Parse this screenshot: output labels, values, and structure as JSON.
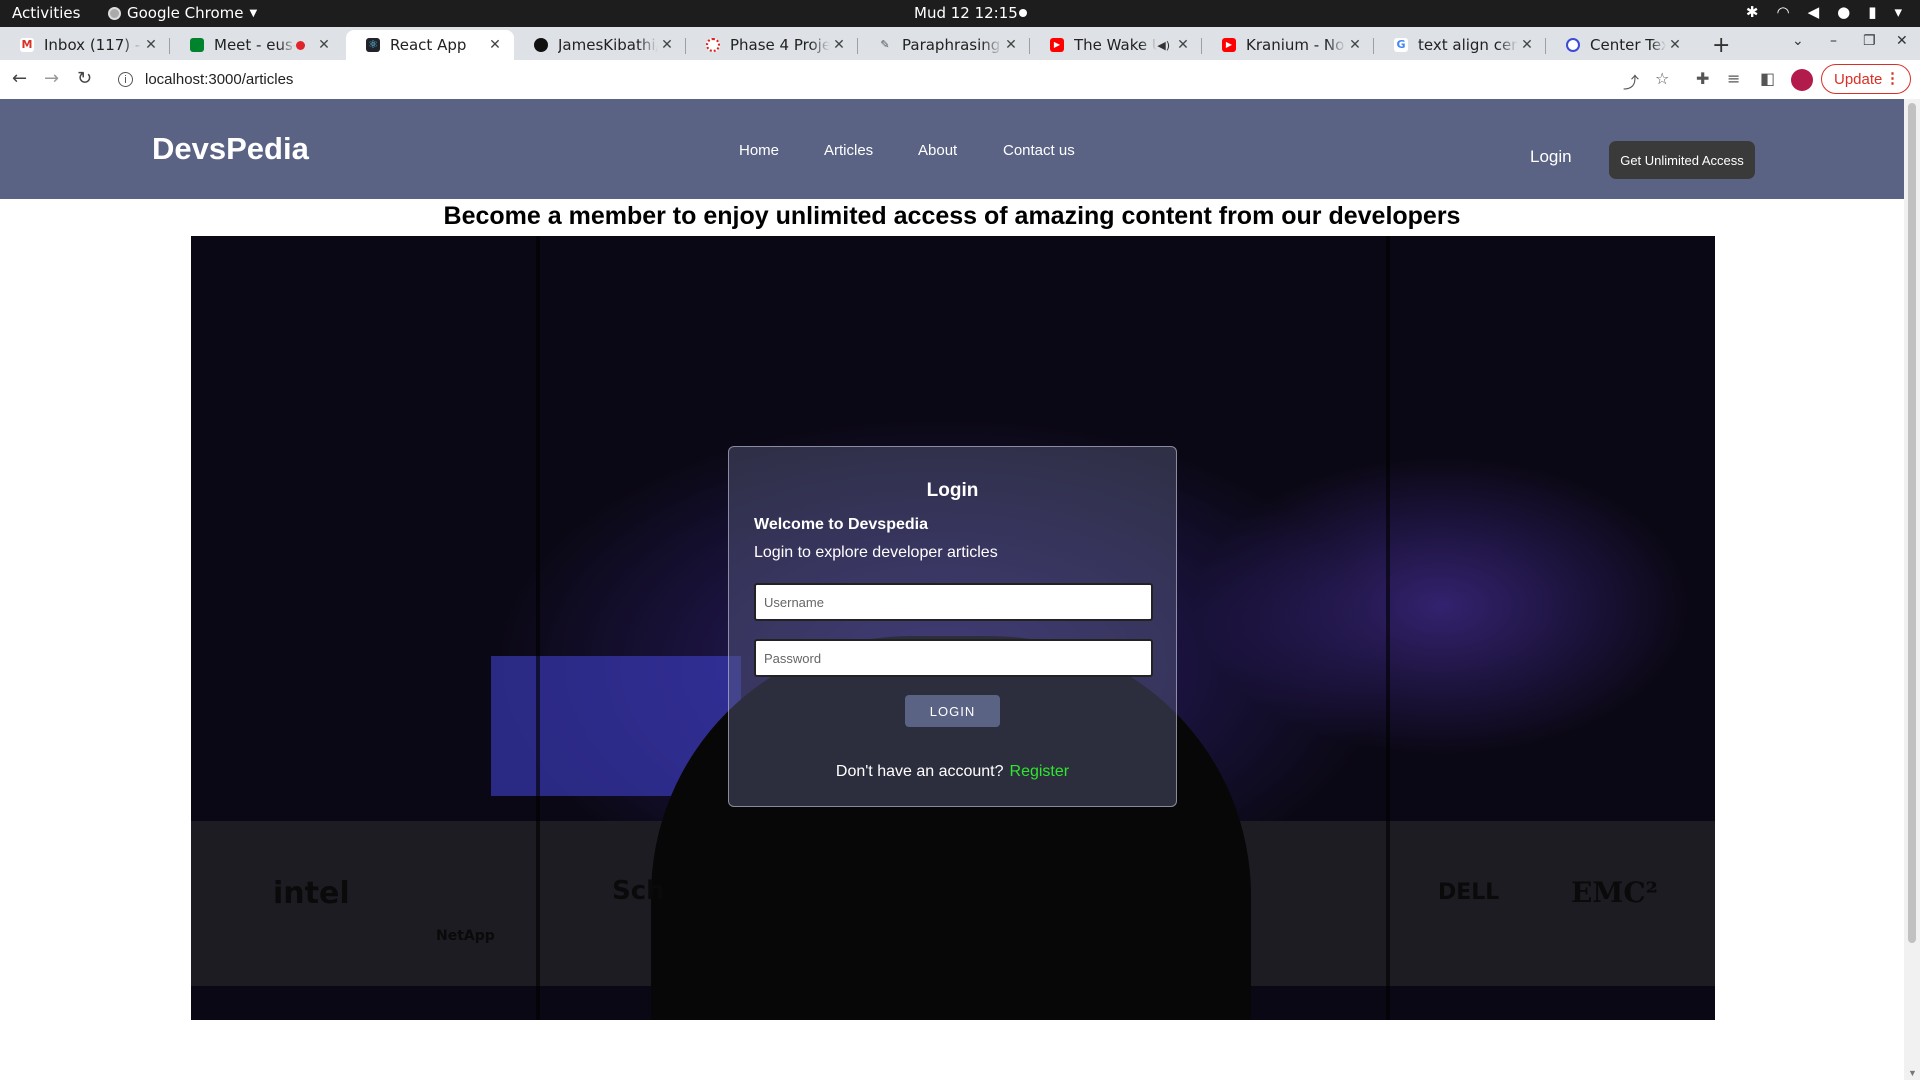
{
  "system_bar": {
    "activities": "Activities",
    "app_name": "Google Chrome",
    "clock": "Mud 12  12:15"
  },
  "browser": {
    "tabs": [
      {
        "title": "Inbox (117) - jar",
        "favicon": "gmail-icon",
        "color": "#d93025"
      },
      {
        "title": "Meet - eus-e",
        "favicon": "meet-icon",
        "color": "#00832d"
      },
      {
        "title": "React App",
        "favicon": "react-icon",
        "color": "#20232a"
      },
      {
        "title": "JamesKibathi/",
        "favicon": "github-icon",
        "color": "#111111"
      },
      {
        "title": "Phase 4 Project",
        "favicon": "phase-icon",
        "color": "#e02020"
      },
      {
        "title": "Paraphrasing T",
        "favicon": "quill-icon",
        "color": "#555555"
      },
      {
        "title": "The Wake U",
        "favicon": "youtube-icon",
        "color": "#ff0000"
      },
      {
        "title": "Kranium - Nobo",
        "favicon": "youtube-icon",
        "color": "#ff0000"
      },
      {
        "title": "text align cente",
        "favicon": "google-icon",
        "color": "#4285f4"
      },
      {
        "title": "Center Text in R",
        "favicon": "globe-icon",
        "color": "#3b4bd8"
      }
    ],
    "url": "localhost:3000/articles",
    "update_label": "Update"
  },
  "site": {
    "brand": "DevsPedia",
    "nav": {
      "home": "Home",
      "articles": "Articles",
      "about": "About",
      "contact": "Contact us"
    },
    "login": "Login",
    "cta": "Get Unlimited Access",
    "headline": "Become a member to enjoy unlimited access of amazing content from our developers",
    "hero_logos": [
      "intel",
      "NetApp",
      "Sch",
      "DELL",
      "EMC²"
    ]
  },
  "login_form": {
    "title": "Login",
    "welcome": "Welcome to Devspedia",
    "subtitle": "Login to explore developer articles",
    "username_placeholder": "Username",
    "password_placeholder": "Password",
    "button": "LOGIN",
    "footer_text": "Don't have an account?",
    "register": "Register"
  }
}
